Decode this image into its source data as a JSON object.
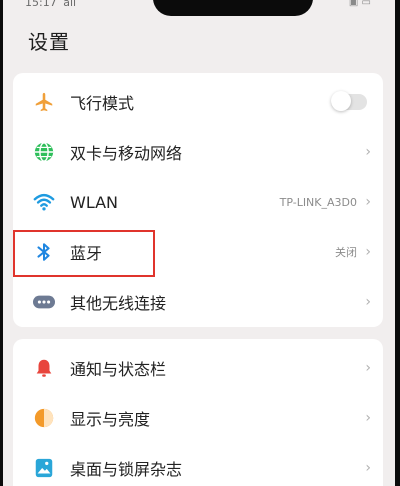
{
  "status_bar": {
    "time": "15:17",
    "signal": "all",
    "right_icons": "▣ ▭"
  },
  "page": {
    "title": "设置"
  },
  "card1": {
    "items": [
      {
        "label": "飞行模式",
        "icon": "airplane-icon",
        "toggle": "off"
      },
      {
        "label": "双卡与移动网络",
        "icon": "globe-icon"
      },
      {
        "label": "WLAN",
        "icon": "wifi-icon",
        "value": "TP-LINK_A3D0"
      },
      {
        "label": "蓝牙",
        "icon": "bluetooth-icon",
        "value": "关闭"
      },
      {
        "label": "其他无线连接",
        "icon": "more-connections-icon"
      }
    ]
  },
  "card2": {
    "items": [
      {
        "label": "通知与状态栏",
        "icon": "bell-icon"
      },
      {
        "label": "显示与亮度",
        "icon": "brightness-icon"
      },
      {
        "label": "桌面与锁屏杂志",
        "icon": "wallpaper-icon"
      }
    ]
  },
  "chevron": "›",
  "colors": {
    "airplane": "#f0a03a",
    "network": "#2fbf5b",
    "wifi": "#1f9be0",
    "bluetooth": "#1f86e0",
    "more": "#6d7a93",
    "bell": "#e8453c",
    "brightness": "#f39a2a",
    "wallpaper": "#2aa6d8",
    "highlight": "#e0342c"
  }
}
